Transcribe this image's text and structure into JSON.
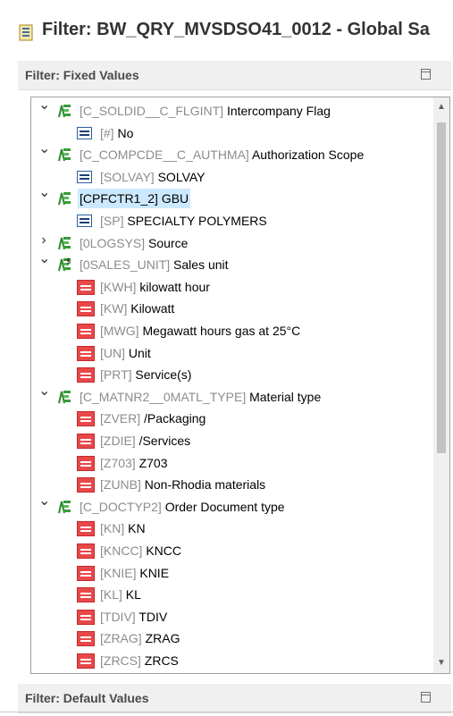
{
  "window": {
    "title": "Filter: BW_QRY_MVSDSO41_0012 - Global Sa"
  },
  "fixed_section": {
    "title": "Filter: Fixed Values"
  },
  "default_section": {
    "title": "Filter: Default Values"
  },
  "tree": [
    {
      "type": "char",
      "level": 0,
      "arrow": "down",
      "code": "[C_SOLDID__C_FLGINT]",
      "text": "Intercompany Flag"
    },
    {
      "type": "incl",
      "level": 1,
      "code": "[#]",
      "text": "No"
    },
    {
      "type": "char",
      "level": 0,
      "arrow": "down",
      "code": "[C_COMPCDE__C_AUTHMA]",
      "text": "Authorization Scope"
    },
    {
      "type": "incl",
      "level": 1,
      "code": "[SOLVAY]",
      "text": "SOLVAY"
    },
    {
      "type": "char",
      "level": 0,
      "arrow": "down",
      "code": "[CPFCTR1_2]",
      "text": "GBU",
      "selected": true,
      "code_dark": true
    },
    {
      "type": "incl",
      "level": 1,
      "code": "[SP]",
      "text": "SPECIALTY POLYMERS"
    },
    {
      "type": "char",
      "level": 0,
      "arrow": "right",
      "code": "[0LOGSYS]",
      "text": "Source"
    },
    {
      "type": "unit",
      "level": 0,
      "arrow": "down",
      "code": "[0SALES_UNIT]",
      "text": "Sales unit"
    },
    {
      "type": "excl",
      "level": 1,
      "code": "[KWH]",
      "text": "kilowatt hour"
    },
    {
      "type": "excl",
      "level": 1,
      "code": "[KW]",
      "text": "Kilowatt"
    },
    {
      "type": "excl",
      "level": 1,
      "code": "[MWG]",
      "text": "Megawatt hours gas at  25°C"
    },
    {
      "type": "excl",
      "level": 1,
      "code": "[UN]",
      "text": "Unit"
    },
    {
      "type": "excl",
      "level": 1,
      "code": "[PRT]",
      "text": "Service(s)"
    },
    {
      "type": "char",
      "level": 0,
      "arrow": "down",
      "code": "[C_MATNR2__0MATL_TYPE]",
      "text": "Material type"
    },
    {
      "type": "excl",
      "level": 1,
      "code": "[ZVER]",
      "text": "/Packaging"
    },
    {
      "type": "excl",
      "level": 1,
      "code": "[ZDIE]",
      "text": "/Services"
    },
    {
      "type": "excl",
      "level": 1,
      "code": "[Z703]",
      "text": "Z703"
    },
    {
      "type": "excl",
      "level": 1,
      "code": "[ZUNB]",
      "text": "Non-Rhodia materials"
    },
    {
      "type": "char",
      "level": 0,
      "arrow": "down",
      "code": "[C_DOCTYP2]",
      "text": "Order Document type"
    },
    {
      "type": "excl",
      "level": 1,
      "code": "[KN]",
      "text": "KN"
    },
    {
      "type": "excl",
      "level": 1,
      "code": "[KNCC]",
      "text": "KNCC"
    },
    {
      "type": "excl",
      "level": 1,
      "code": "[KNIE]",
      "text": "KNIE"
    },
    {
      "type": "excl",
      "level": 1,
      "code": "[KL]",
      "text": "KL"
    },
    {
      "type": "excl",
      "level": 1,
      "code": "[TDIV]",
      "text": "TDIV"
    },
    {
      "type": "excl",
      "level": 1,
      "code": "[ZRAG]",
      "text": "ZRAG"
    },
    {
      "type": "excl",
      "level": 1,
      "code": "[ZRCS]",
      "text": "ZRCS"
    }
  ],
  "icons": {
    "char": "characteristic-icon",
    "unit": "unit-characteristic-icon",
    "incl": "include-filter-icon",
    "excl": "exclude-filter-icon"
  },
  "colors": {
    "include_border": "#2d5fa0",
    "exclude_fill": "#e8484a",
    "char_green": "#2e8b2e",
    "selected_bg": "#cce8ff"
  }
}
